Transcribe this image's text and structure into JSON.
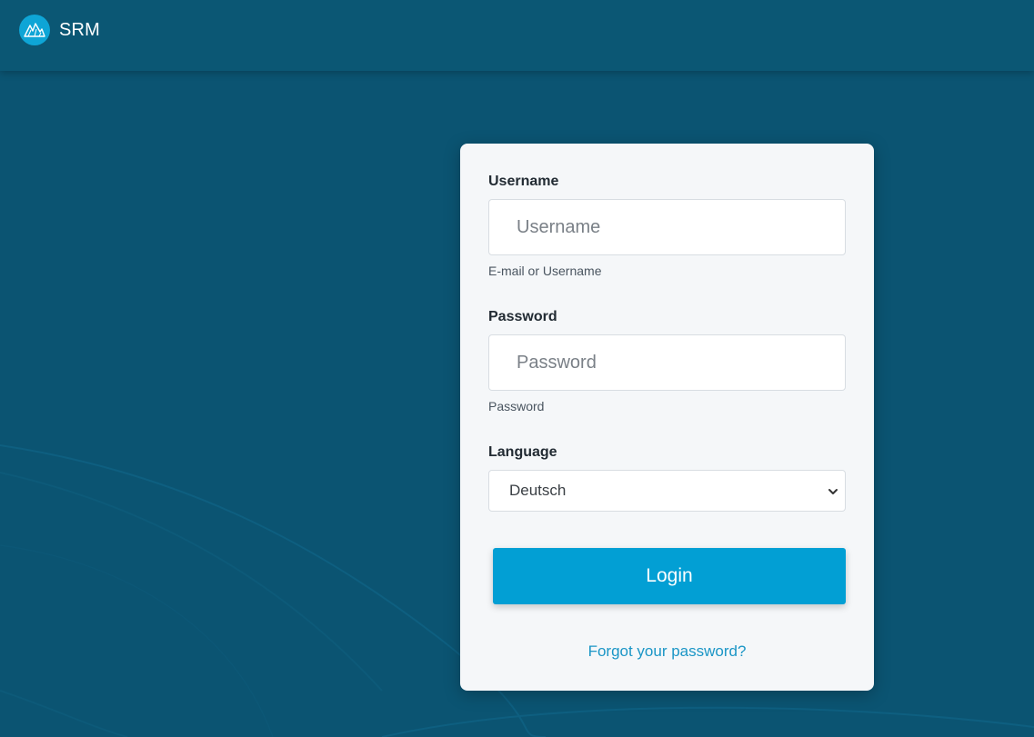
{
  "header": {
    "brand_name": "SRM",
    "logo_icon": "mountain-logo-icon"
  },
  "login_form": {
    "username": {
      "label": "Username",
      "placeholder": "Username",
      "value": "",
      "help_text": "E-mail or Username"
    },
    "password": {
      "label": "Password",
      "placeholder": "Password",
      "value": "",
      "help_text": "Password"
    },
    "language": {
      "label": "Language",
      "selected": "Deutsch",
      "icon": "chevron-down-icon"
    },
    "login_label": "Login",
    "forgot_password_label": "Forgot your password?"
  },
  "colors": {
    "background": "#0b5472",
    "header": "#0b5774",
    "card": "#f5f7f9",
    "accent": "#029fd4",
    "link": "#1b96c6"
  }
}
